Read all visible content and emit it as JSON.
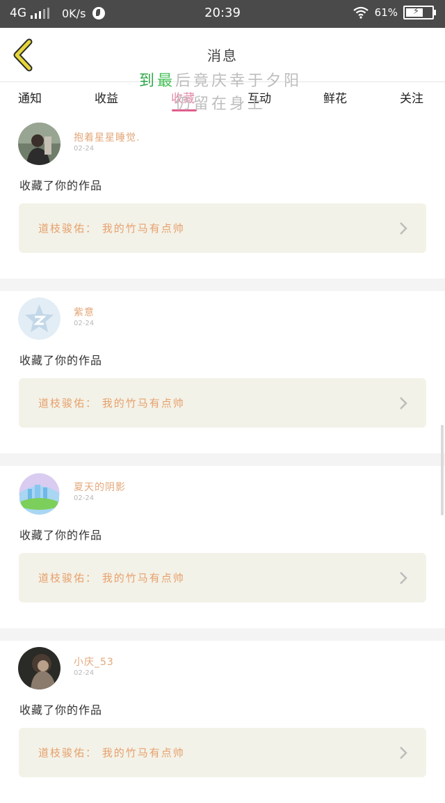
{
  "status_bar": {
    "network": "4G",
    "speed": "0K/s",
    "time": "20:39",
    "battery": "61%"
  },
  "header": {
    "title": "消息"
  },
  "sticker": {
    "line1": [
      "到",
      "最",
      "后",
      "竟",
      "庆",
      "幸",
      "于",
      "夕",
      "阳"
    ],
    "line2": "仍留在身上"
  },
  "tabs": [
    {
      "label": "通知"
    },
    {
      "label": "收益"
    },
    {
      "label": "收藏"
    },
    {
      "label": "互动"
    },
    {
      "label": "鲜花"
    },
    {
      "label": "关注"
    }
  ],
  "active_tab": "收藏",
  "messages": [
    {
      "user": "抱着星星睡觉.",
      "date": "02-24",
      "action": "收藏了你的作品",
      "work": "道枝骏佑：  我的竹马有点帅",
      "avatar": "avatar-photo"
    },
    {
      "user": "紫意",
      "date": "02-24",
      "action": "收藏了你的作品",
      "work": "道枝骏佑：  我的竹马有点帅",
      "avatar": "qq-star-icon"
    },
    {
      "user": "夏天的阴影",
      "date": "02-24",
      "action": "收藏了你的作品",
      "work": "道枝骏佑：  我的竹马有点帅",
      "avatar": "castle-avatar"
    },
    {
      "user": "小庆_53",
      "date": "02-24",
      "action": "收藏了你的作品",
      "work": "道枝骏佑：  我的竹马有点帅",
      "avatar": "avatar-photo"
    }
  ],
  "colors": {
    "accent_pink": "#e25b8a",
    "username": "#e3a77a",
    "work_text": "#e6a06c",
    "work_bg": "#f3f2e8",
    "back_arrow": "#e6d63a"
  }
}
